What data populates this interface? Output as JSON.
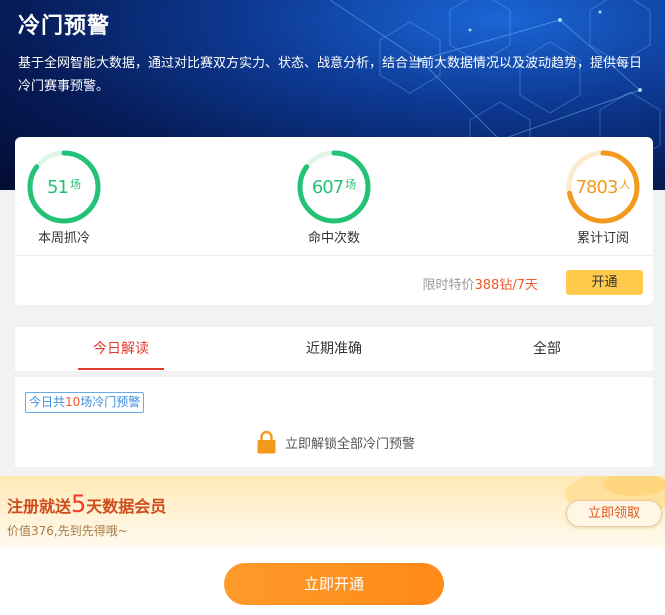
{
  "header": {
    "title": "冷门预警",
    "description": "基于全网智能大数据，通过对比赛双方实力、状态、战意分析，结合当前大数据情况以及波动趋势，提供每日冷门赛事预警。"
  },
  "stats": {
    "items": [
      {
        "value": "51",
        "unit": "场",
        "label": "本周抓冷",
        "ring_progress": 0.85,
        "color": "#23c277"
      },
      {
        "value": "607",
        "unit": "场",
        "label": "命中次数",
        "ring_progress": 0.85,
        "color": "#23c277"
      },
      {
        "value": "7803",
        "unit": "人",
        "label": "累计订阅",
        "ring_progress": 0.72,
        "color": "#f39a1e"
      }
    ],
    "promo_prefix": "限时特价",
    "promo_price": "388钻",
    "promo_period": "/7天",
    "open_label": "开通"
  },
  "tabs": [
    {
      "label": "今日解读",
      "active": true
    },
    {
      "label": "近期准确",
      "active": false
    },
    {
      "label": "全部",
      "active": false
    }
  ],
  "today": {
    "tag_prefix": "今日共",
    "tag_count": "10",
    "tag_suffix": "场冷门预警",
    "unlock_label": "立即解锁全部冷门预警"
  },
  "banner": {
    "title_prefix": "注册就送",
    "title_number": "5",
    "title_suffix": "天数据会员",
    "subtitle": "价值376,先到先得哦~",
    "claim_label": "立即领取"
  },
  "footer": {
    "main_button": "立即开通"
  },
  "colors": {
    "green": "#23c277",
    "orange": "#f39a1e",
    "accent_red": "#e23b2e",
    "button_yellow": "#ffc94a",
    "main_button": "#ff8a18"
  },
  "icons": [
    "lock-icon"
  ]
}
